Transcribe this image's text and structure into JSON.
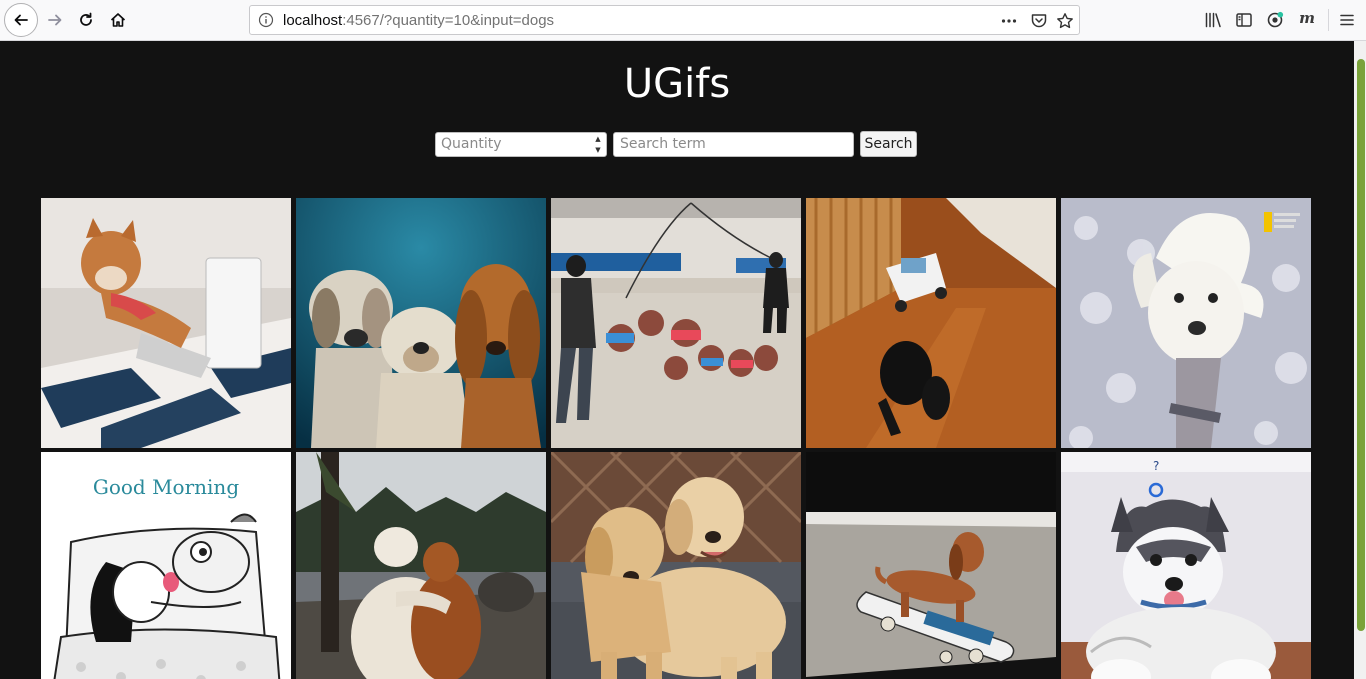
{
  "browser": {
    "url_host": "localhost",
    "url_rest": ":4567/?quantity=10&input=dogs"
  },
  "page": {
    "title": "UGifs",
    "search": {
      "quantity_placeholder": "Quantity",
      "term_placeholder": "Search term",
      "button_label": "Search"
    },
    "gifs": [
      {
        "name": "shiba-with-laptop",
        "palette": [
          "#d9d4cf",
          "#f0ece8",
          "#c8743b",
          "#1f3c5a"
        ]
      },
      {
        "name": "three-dogs-teal",
        "palette": [
          "#0b3f57",
          "#1d6f8a",
          "#d8d2c4",
          "#b36a2c"
        ]
      },
      {
        "name": "dogs-jump-rope",
        "palette": [
          "#cfc8bd",
          "#a9a39a",
          "#8c4a3c",
          "#2c2c2c"
        ]
      },
      {
        "name": "dog-with-toy-car",
        "palette": [
          "#7a3a14",
          "#b65f24",
          "#eeeeee",
          "#1b1b1b"
        ]
      },
      {
        "name": "windy-white-dog",
        "palette": [
          "#b9bccb",
          "#e6e7ee",
          "#f5f3ee",
          "#555566"
        ]
      },
      {
        "name": "good-morning-cartoon",
        "palette": [
          "#ffffff",
          "#e6e6e6",
          "#1a1a1a",
          "#2a8a9b"
        ]
      },
      {
        "name": "two-dogs-hugging",
        "palette": [
          "#6f6e68",
          "#2e3b2d",
          "#e9e3d6",
          "#9a4e20"
        ]
      },
      {
        "name": "golden-retrievers",
        "palette": [
          "#6b4a38",
          "#4a4e55",
          "#e3c495",
          "#c89b63"
        ]
      },
      {
        "name": "dachshund-skateboard",
        "palette": [
          "#0d0d0d",
          "#a7a39c",
          "#a75a2d",
          "#f1f1f1"
        ]
      },
      {
        "name": "husky-puppy",
        "palette": [
          "#e8e6ec",
          "#c9c3cf",
          "#4c4c54",
          "#fafafa"
        ]
      }
    ],
    "good_morning_text": "Good Morning",
    "gif_logo_text": "NATIONAL GEOGRAPHIC CHANNEL"
  }
}
